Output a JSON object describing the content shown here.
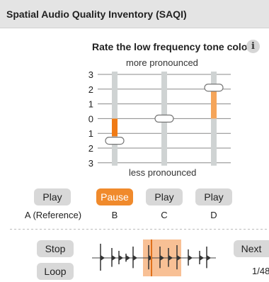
{
  "header": {
    "title": "Spatial Audio Quality Inventory (SAQI)"
  },
  "question": {
    "text": "Rate the low frequency tone color",
    "info_icon": "info-icon",
    "top_label": "more pronounced",
    "bottom_label": "less pronounced"
  },
  "scale": {
    "ticks": [
      "3",
      "2",
      "1",
      "0",
      "1",
      "2",
      "3"
    ],
    "accent_color": "#f5a55a",
    "accent_dark": "#f07a14",
    "track_color": "#cfd3d3"
  },
  "conditions": [
    {
      "button_label": "Play",
      "label": "A (Reference)",
      "active": false,
      "rating": -1.5
    },
    {
      "button_label": "Pause",
      "label": "B",
      "active": true,
      "rating": 0
    },
    {
      "button_label": "Play",
      "label": "C",
      "active": false,
      "rating": 0
    },
    {
      "button_label": "Play",
      "label": "D",
      "active": false,
      "rating": 2.1
    }
  ],
  "transport": {
    "stop_label": "Stop",
    "loop_label": "Loop",
    "next_label": "Next",
    "counter": "1/48"
  }
}
